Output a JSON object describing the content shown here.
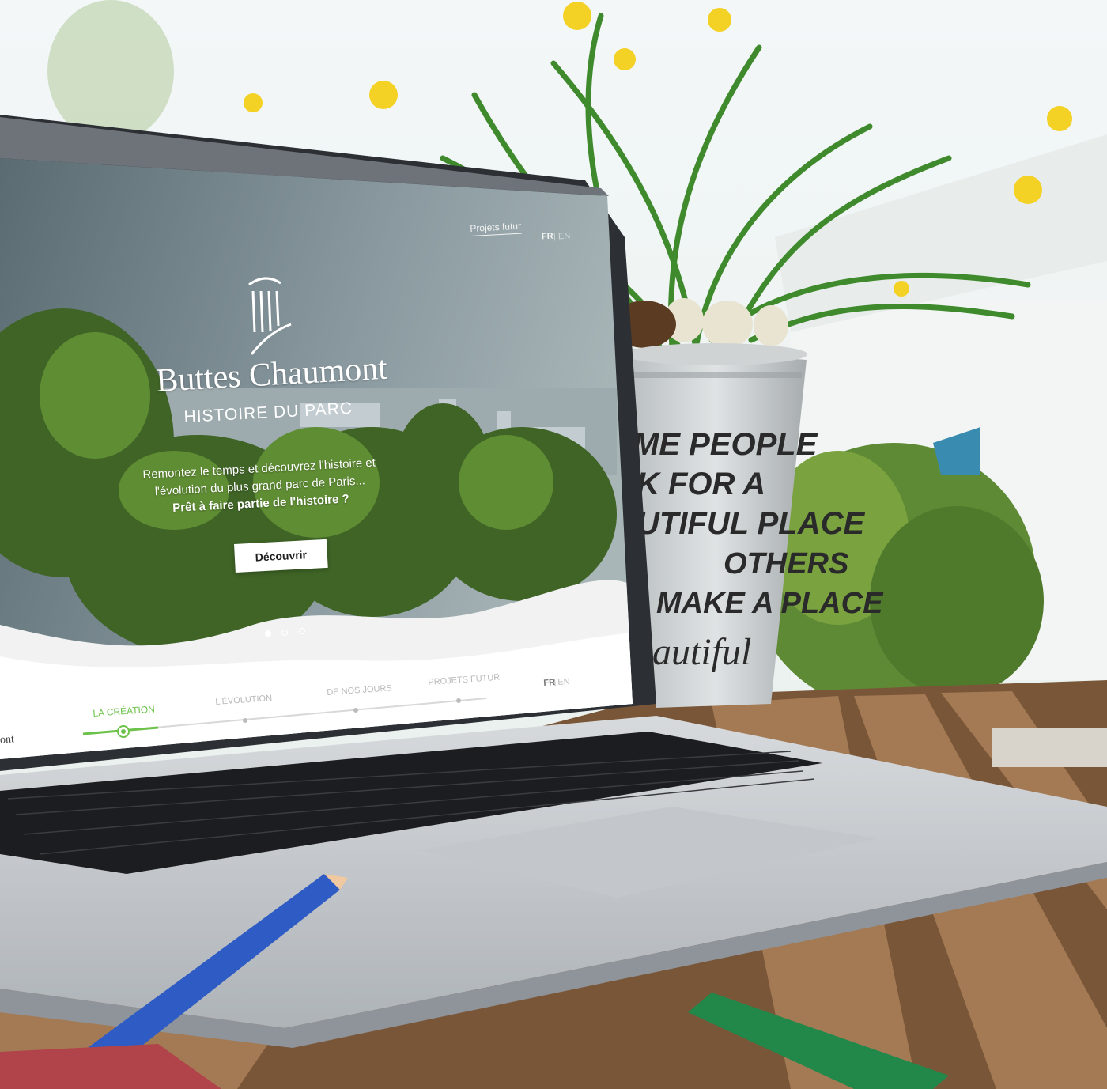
{
  "site": {
    "nav_link": "Projets futur",
    "lang": {
      "fr": "FR",
      "separator": "|",
      "en": "EN"
    },
    "title": "Buttes Chaumont",
    "subtitle": "HISTOIRE DU PARC",
    "intro_line1": "Remontez le temps et découvrez l'histoire et",
    "intro_line2": "l'évolution du plus grand parc de Paris...",
    "intro_bold": "Prêt à faire partie de l'histoire ?",
    "cta_label": "Découvrir",
    "slides": {
      "count": 3,
      "active": 1
    }
  },
  "timeline": {
    "brand_fragment": "ont",
    "items": [
      {
        "label": "LA CRÉATION",
        "active": true
      },
      {
        "label": "L'ÉVOLUTION",
        "active": false
      },
      {
        "label": "DE NOS JOURS",
        "active": false
      },
      {
        "label": "PROJETS FUTUR",
        "active": false
      }
    ],
    "lang": {
      "fr": "FR",
      "separator": "|",
      "en": "EN"
    }
  },
  "pot_text": [
    "ME PEOPLE",
    "K FOR A",
    "UTIFUL PLACE",
    "OTHERS",
    "MAKE A PLACE",
    "autiful"
  ],
  "colors": {
    "accent_green": "#6cc24a",
    "white": "#ffffff",
    "laptop_silver": "#c9ccd0"
  },
  "icons": {
    "logo": "column-logo-icon"
  }
}
